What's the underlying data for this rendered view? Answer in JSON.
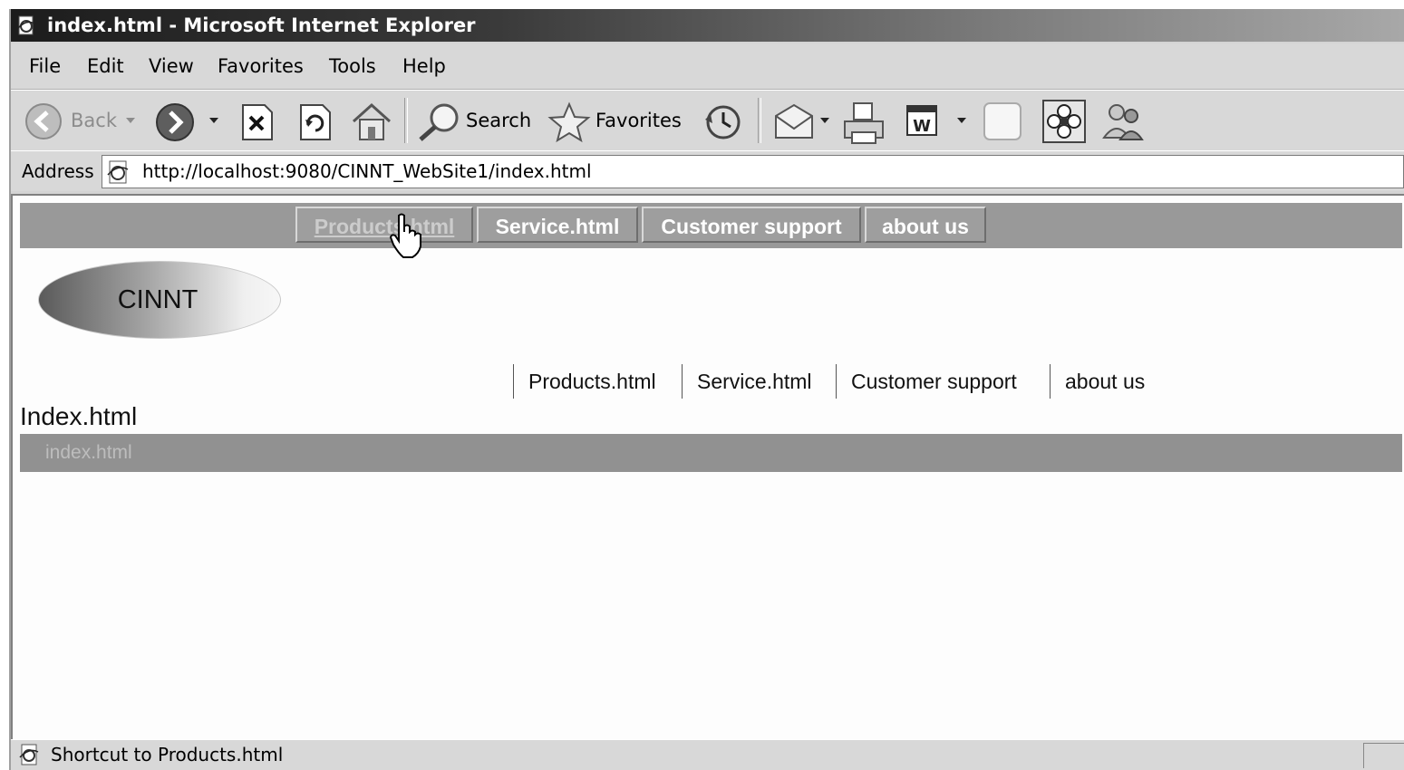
{
  "window": {
    "title": "index.html - Microsoft Internet Explorer"
  },
  "menu": {
    "items": [
      "File",
      "Edit",
      "View",
      "Favorites",
      "Tools",
      "Help"
    ]
  },
  "toolbar": {
    "back_label": "Back",
    "search_label": "Search",
    "favorites_label": "Favorites"
  },
  "address": {
    "label": "Address",
    "url": "http://localhost:9080/CINNT_WebSite1/index.html"
  },
  "page": {
    "topnav": [
      "Products.html",
      "Service.html",
      "Customer support",
      "about us"
    ],
    "logo_text": "CINNT",
    "subnav": [
      "Products.html",
      "Service.html",
      "Customer support",
      "about us"
    ],
    "heading": "Index.html",
    "breadcrumb": "index.html"
  },
  "status": {
    "text": "Shortcut to Products.html"
  }
}
